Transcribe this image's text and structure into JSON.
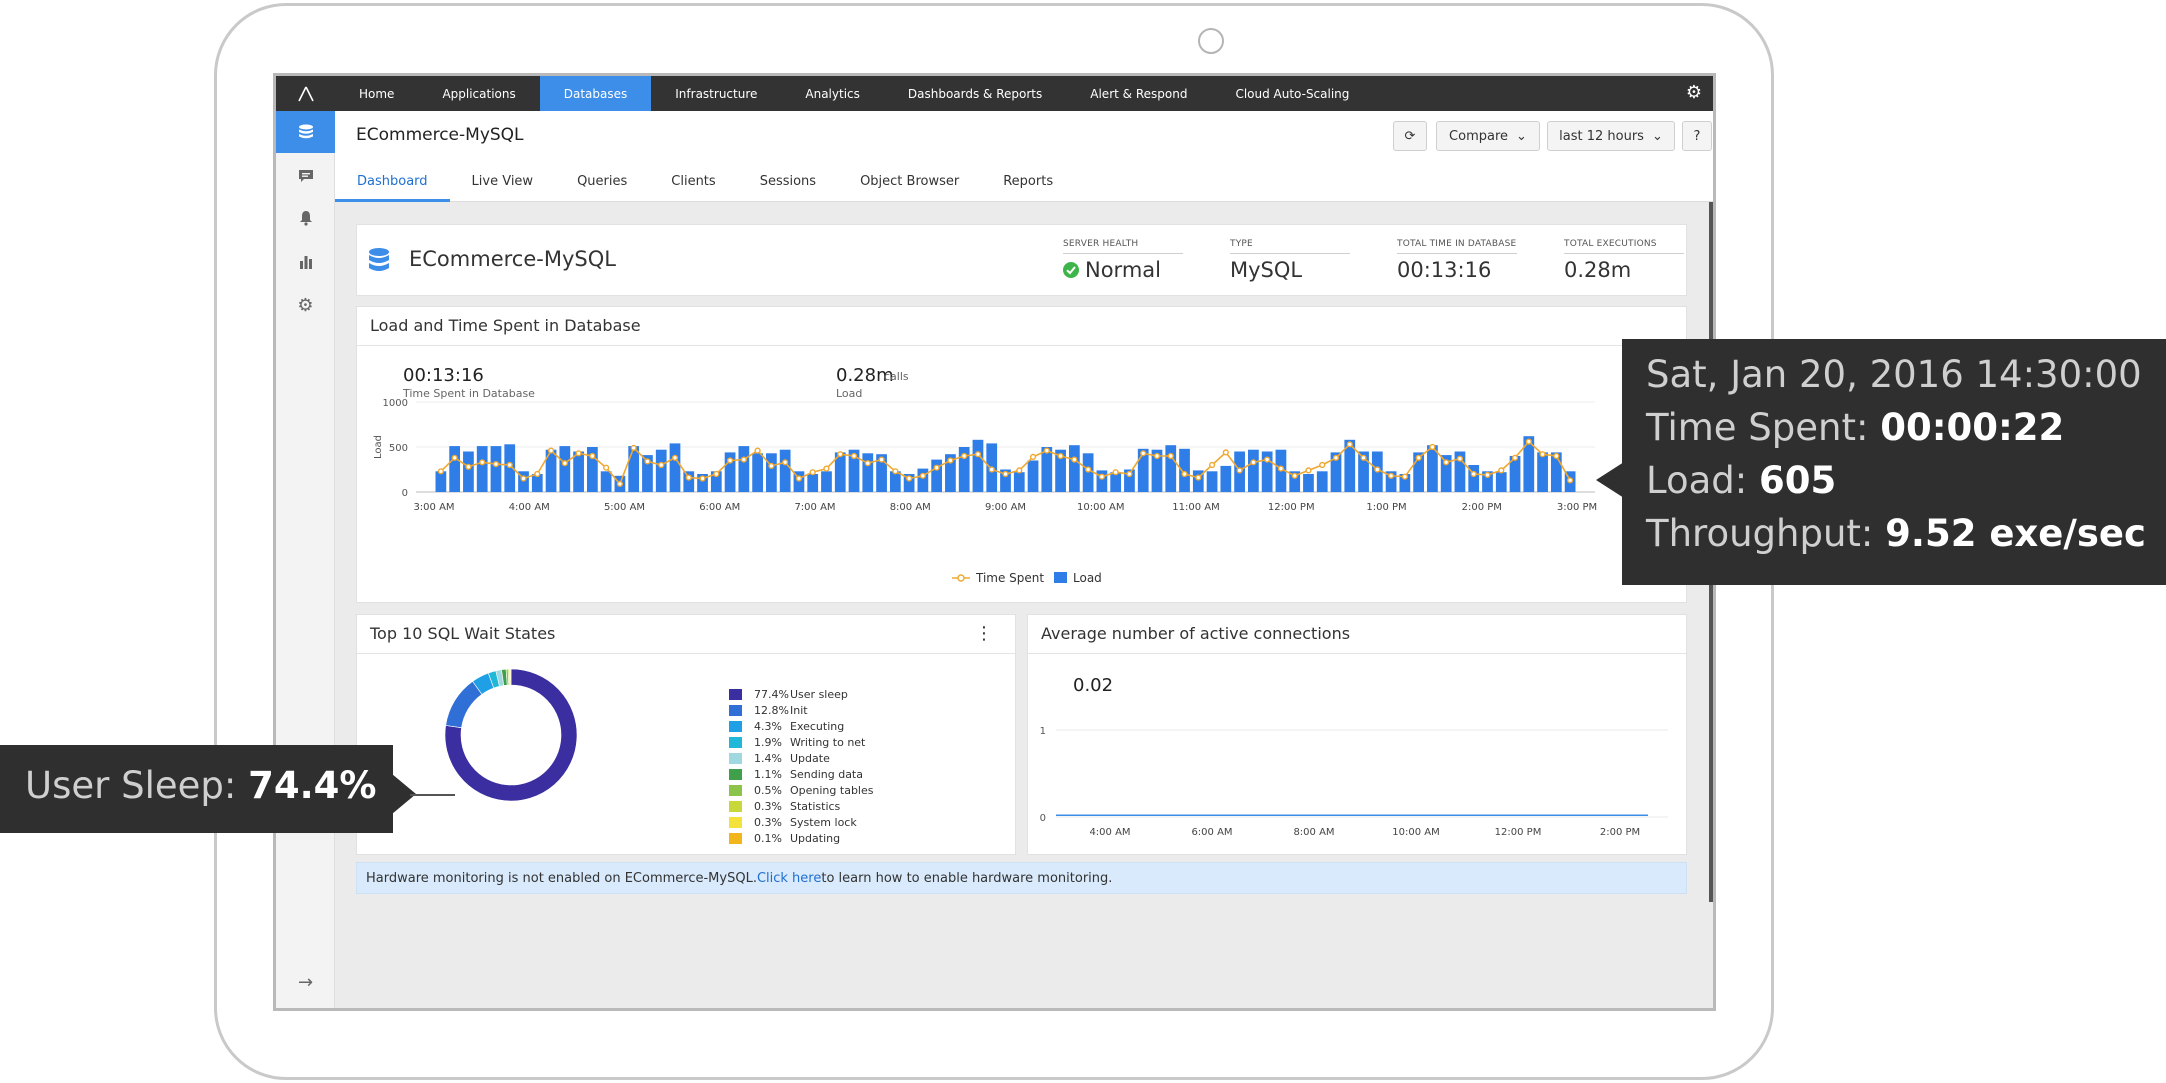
{
  "nav": {
    "items": [
      "Home",
      "Applications",
      "Databases",
      "Infrastructure",
      "Analytics",
      "Dashboards & Reports",
      "Alert & Respond",
      "Cloud Auto-Scaling"
    ],
    "active": "Databases"
  },
  "header": {
    "title": "ECommerce-MySQL",
    "compare_label": "Compare",
    "range_label": "last 12 hours",
    "help_label": "?"
  },
  "tabs": [
    "Dashboard",
    "Live View",
    "Queries",
    "Clients",
    "Sessions",
    "Object Browser",
    "Reports"
  ],
  "summary": {
    "name": "ECommerce-MySQL",
    "health_label": "Server Health",
    "health_value": "Normal",
    "type_label": "Type",
    "type_value": "MySQL",
    "time_label": "Total Time in Database",
    "time_value": "00:13:16",
    "exec_label": "Total Executions",
    "exec_value": "0.28m"
  },
  "load_panel": {
    "title": "Load and Time Spent in Database",
    "time_value": "00:13:16",
    "time_caption": "Time Spent in Database",
    "load_value": "0.28m",
    "load_unit": "calls",
    "load_caption": "Load",
    "legend_time": "Time Spent",
    "legend_load": "Load"
  },
  "wait_panel": {
    "title": "Top 10 SQL Wait States",
    "menu_icon": "more-vertical-icon"
  },
  "conn_panel": {
    "title": "Average number of active connections",
    "current_value": "0.02"
  },
  "notice": {
    "before": "Hardware monitoring is not enabled on ECommerce-MySQL. ",
    "link": "Click here",
    "after": " to learn how to enable hardware monitoring."
  },
  "tooltip": {
    "date": "Sat, Jan 20, 2016 14:30:00",
    "time_label": "Time Spent: ",
    "time_value": "00:00:22",
    "load_label": "Load: ",
    "load_value": "605",
    "throughput_label": "Throughput: ",
    "throughput_value": "9.52 exe/sec"
  },
  "sleep_callout": {
    "label": "User Sleep: ",
    "value": "74.4%"
  },
  "colors": {
    "accent": "#3d8ee8",
    "topnav": "#333333",
    "bar": "#2f7de6",
    "line": "#f0a830",
    "donut_main": "#3a2ea0",
    "ok": "#3db54a"
  },
  "chart_data": [
    {
      "type": "bar",
      "title": "Load and Time Spent in Database",
      "ylabel": "Load",
      "ylim": [
        0,
        1000
      ],
      "yticks": [
        "1000",
        "500",
        "0"
      ],
      "xticks": [
        "3:00 AM",
        "4:00 AM",
        "5:00 AM",
        "6:00 AM",
        "7:00 AM",
        "8:00 AM",
        "9:00 AM",
        "10:00 AM",
        "11:00 AM",
        "12:00 PM",
        "1:00 PM",
        "2:00 PM",
        "3:00 PM"
      ],
      "series": [
        {
          "name": "Load",
          "values": [
            230,
            510,
            450,
            510,
            510,
            530,
            230,
            200,
            470,
            510,
            450,
            500,
            230,
            180,
            510,
            410,
            470,
            540,
            230,
            200,
            230,
            440,
            510,
            430,
            430,
            470,
            230,
            200,
            230,
            440,
            470,
            430,
            420,
            230,
            200,
            260,
            360,
            420,
            500,
            580,
            540,
            250,
            220,
            350,
            500,
            470,
            520,
            430,
            240,
            220,
            250,
            480,
            470,
            520,
            480,
            240,
            230,
            290,
            450,
            470,
            450,
            470,
            230,
            200,
            230,
            440,
            580,
            450,
            450,
            230,
            200,
            440,
            520,
            410,
            450,
            300,
            230,
            220,
            400,
            620,
            440,
            440,
            230
          ]
        },
        {
          "name": "Time Spent",
          "values": [
            230,
            380,
            280,
            330,
            310,
            300,
            150,
            200,
            460,
            320,
            430,
            400,
            270,
            90,
            490,
            340,
            300,
            380,
            160,
            150,
            200,
            350,
            360,
            460,
            290,
            330,
            150,
            220,
            260,
            420,
            400,
            320,
            360,
            230,
            150,
            180,
            270,
            350,
            400,
            420,
            250,
            200,
            240,
            390,
            460,
            400,
            360,
            250,
            170,
            220,
            200,
            430,
            400,
            400,
            200,
            160,
            300,
            440,
            240,
            330,
            360,
            260,
            180,
            240,
            300,
            380,
            530,
            380,
            250,
            180,
            170,
            380,
            500,
            330,
            370,
            200,
            190,
            240,
            380,
            560,
            420,
            400,
            130
          ]
        }
      ]
    },
    {
      "type": "pie",
      "title": "Top 10 SQL Wait States",
      "categories": [
        "User sleep",
        "Init",
        "Executing",
        "Writing to net",
        "Update",
        "Sending data",
        "Opening tables",
        "Statistics",
        "System lock",
        "Updating"
      ],
      "values": [
        77.4,
        12.8,
        4.3,
        1.9,
        1.4,
        1.1,
        0.5,
        0.3,
        0.3,
        0.1
      ],
      "labels": [
        "77.4%",
        "12.8%",
        "4.3%",
        "1.9%",
        "1.4%",
        "1.1%",
        "0.5%",
        "0.3%",
        "0.3%",
        "0.1%"
      ],
      "colors": [
        "#3a2ea0",
        "#2f6fd6",
        "#1f9fe6",
        "#1fb8d8",
        "#9fd8e0",
        "#3f9f4a",
        "#8cc34a",
        "#c8d83a",
        "#f2e23a",
        "#f2b61a"
      ]
    },
    {
      "type": "line",
      "title": "Average number of active connections",
      "ylim": [
        0,
        1
      ],
      "yticks": [
        "1",
        "0"
      ],
      "xticks": [
        "4:00 AM",
        "6:00 AM",
        "8:00 AM",
        "10:00 AM",
        "12:00 PM",
        "2:00 PM"
      ],
      "values": [
        0.02
      ]
    }
  ]
}
